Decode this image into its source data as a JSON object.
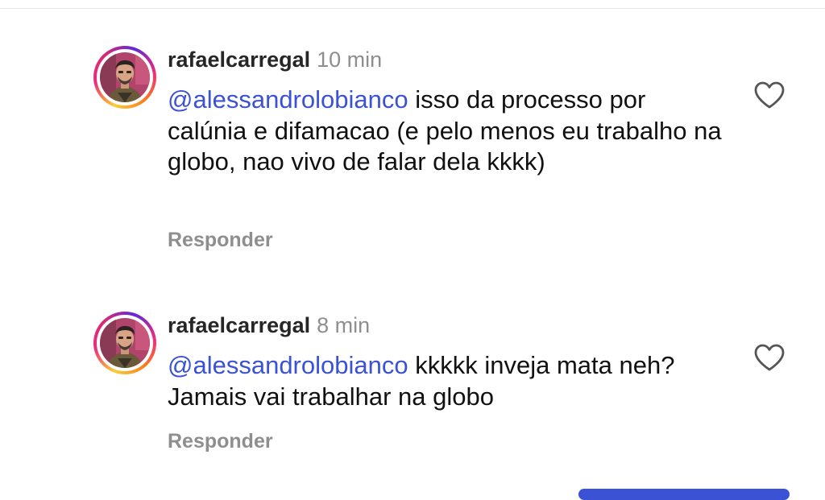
{
  "comments": [
    {
      "username": "rafaelcarregal",
      "time": "10 min",
      "mention": "@alessandrolobianco",
      "text": " isso da processo por calúnia e difamacao (e pelo menos eu trabalho na globo, nao vivo de falar dela kkkk)",
      "reply_label": "Responder",
      "like_icon": "heart-outline-icon"
    },
    {
      "username": "rafaelcarregal",
      "time": "8 min",
      "mention": "@alessandrolobianco",
      "text": " kkkkk inveja mata neh? Jamais vai trabalhar na globo",
      "reply_label": "Responder",
      "like_icon": "heart-outline-icon"
    }
  ],
  "colors": {
    "mention": "#3b52d4",
    "muted": "#8e8e8e",
    "text": "#111111",
    "story_ring": [
      "#f9ce34",
      "#ee2a7b",
      "#6228d7"
    ]
  }
}
